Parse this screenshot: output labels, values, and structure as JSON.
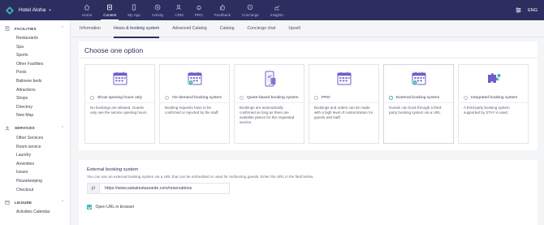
{
  "brand": {
    "name": "Hotel Aloha",
    "caret": "▾"
  },
  "nav": [
    {
      "label": "Home",
      "icon": "home-icon"
    },
    {
      "label": "Content",
      "icon": "content-icon",
      "active": true
    },
    {
      "label": "My App",
      "icon": "phone-icon"
    },
    {
      "label": "Activity",
      "icon": "activity-icon"
    },
    {
      "label": "CRM",
      "icon": "users-icon"
    },
    {
      "label": "PRO",
      "icon": "bell-icon"
    },
    {
      "label": "Feedback",
      "icon": "thumbs-up-icon"
    },
    {
      "label": "Concierge",
      "icon": "chat-icon"
    },
    {
      "label": "Insights",
      "icon": "chart-icon"
    }
  ],
  "topright": {
    "language": "ENG",
    "icon": "settings-sliders-icon"
  },
  "sidebar": {
    "facilities": {
      "title": "FACILITIES",
      "items": [
        "Restaurants",
        "Spa",
        "Sports",
        "Other Facilities",
        "Pools",
        "Balinese beds",
        "Attractions",
        "Shops",
        "Directory",
        "New Map"
      ]
    },
    "services": {
      "title": "SERVICES",
      "items": [
        "Other Services",
        "Room service",
        "Laundry",
        "Amenities",
        "Issues",
        "Housekeeping",
        "Checkout"
      ]
    },
    "leisure": {
      "title": "LEISURE",
      "items": [
        "Activities Calendar"
      ]
    }
  },
  "tabs": [
    {
      "label": "Information"
    },
    {
      "label": "Hours & booking system",
      "active": true
    },
    {
      "label": "Advanced Catalog"
    },
    {
      "label": "Catalog"
    },
    {
      "label": "Concierge chat"
    },
    {
      "label": "Upsell"
    }
  ],
  "choose": {
    "title": "Choose one option",
    "options": [
      {
        "label": "Show opening hours only",
        "desc": "No bookings are allowed. Guests only see the service opening hours.",
        "icon": "calendar-icon",
        "selected": false
      },
      {
        "label": "On-demand booking system",
        "desc": "Booking requests have to be confirmed or rejected by the staff.",
        "icon": "calendar-clock-icon",
        "selected": false
      },
      {
        "label": "Quote-based booking system",
        "desc": "Bookings are automatically confirmed as long as there are available places for the requested service.",
        "icon": "phone-booking-icon",
        "selected": false
      },
      {
        "label": "PRO",
        "desc": "Bookings and orders can be made with a high level of customization for guests and staff.",
        "icon": "calendar-icon",
        "selected": false
      },
      {
        "label": "External booking system",
        "desc": "Guests can book through a third-party booking system via a URL.",
        "icon": "calendar-link-icon",
        "selected": true
      },
      {
        "label": "Integrated booking system",
        "desc": "A third-party booking system supported by STAY is used.",
        "icon": "puzzle-icon",
        "selected": false
      }
    ]
  },
  "external": {
    "title": "External booking system",
    "help": "You can use an external booking system via a URL that can be embedded or used for redirecting guests. Enter the URL in the field below.",
    "url": "https://www.sakairestaurante.com/reservations",
    "open_label": "Open URL in browser",
    "open_checked": true
  },
  "colors": {
    "nav_bg": "#2b2e5f",
    "accent": "#3fb6b0",
    "icon_purple": "#6c5fc7"
  }
}
